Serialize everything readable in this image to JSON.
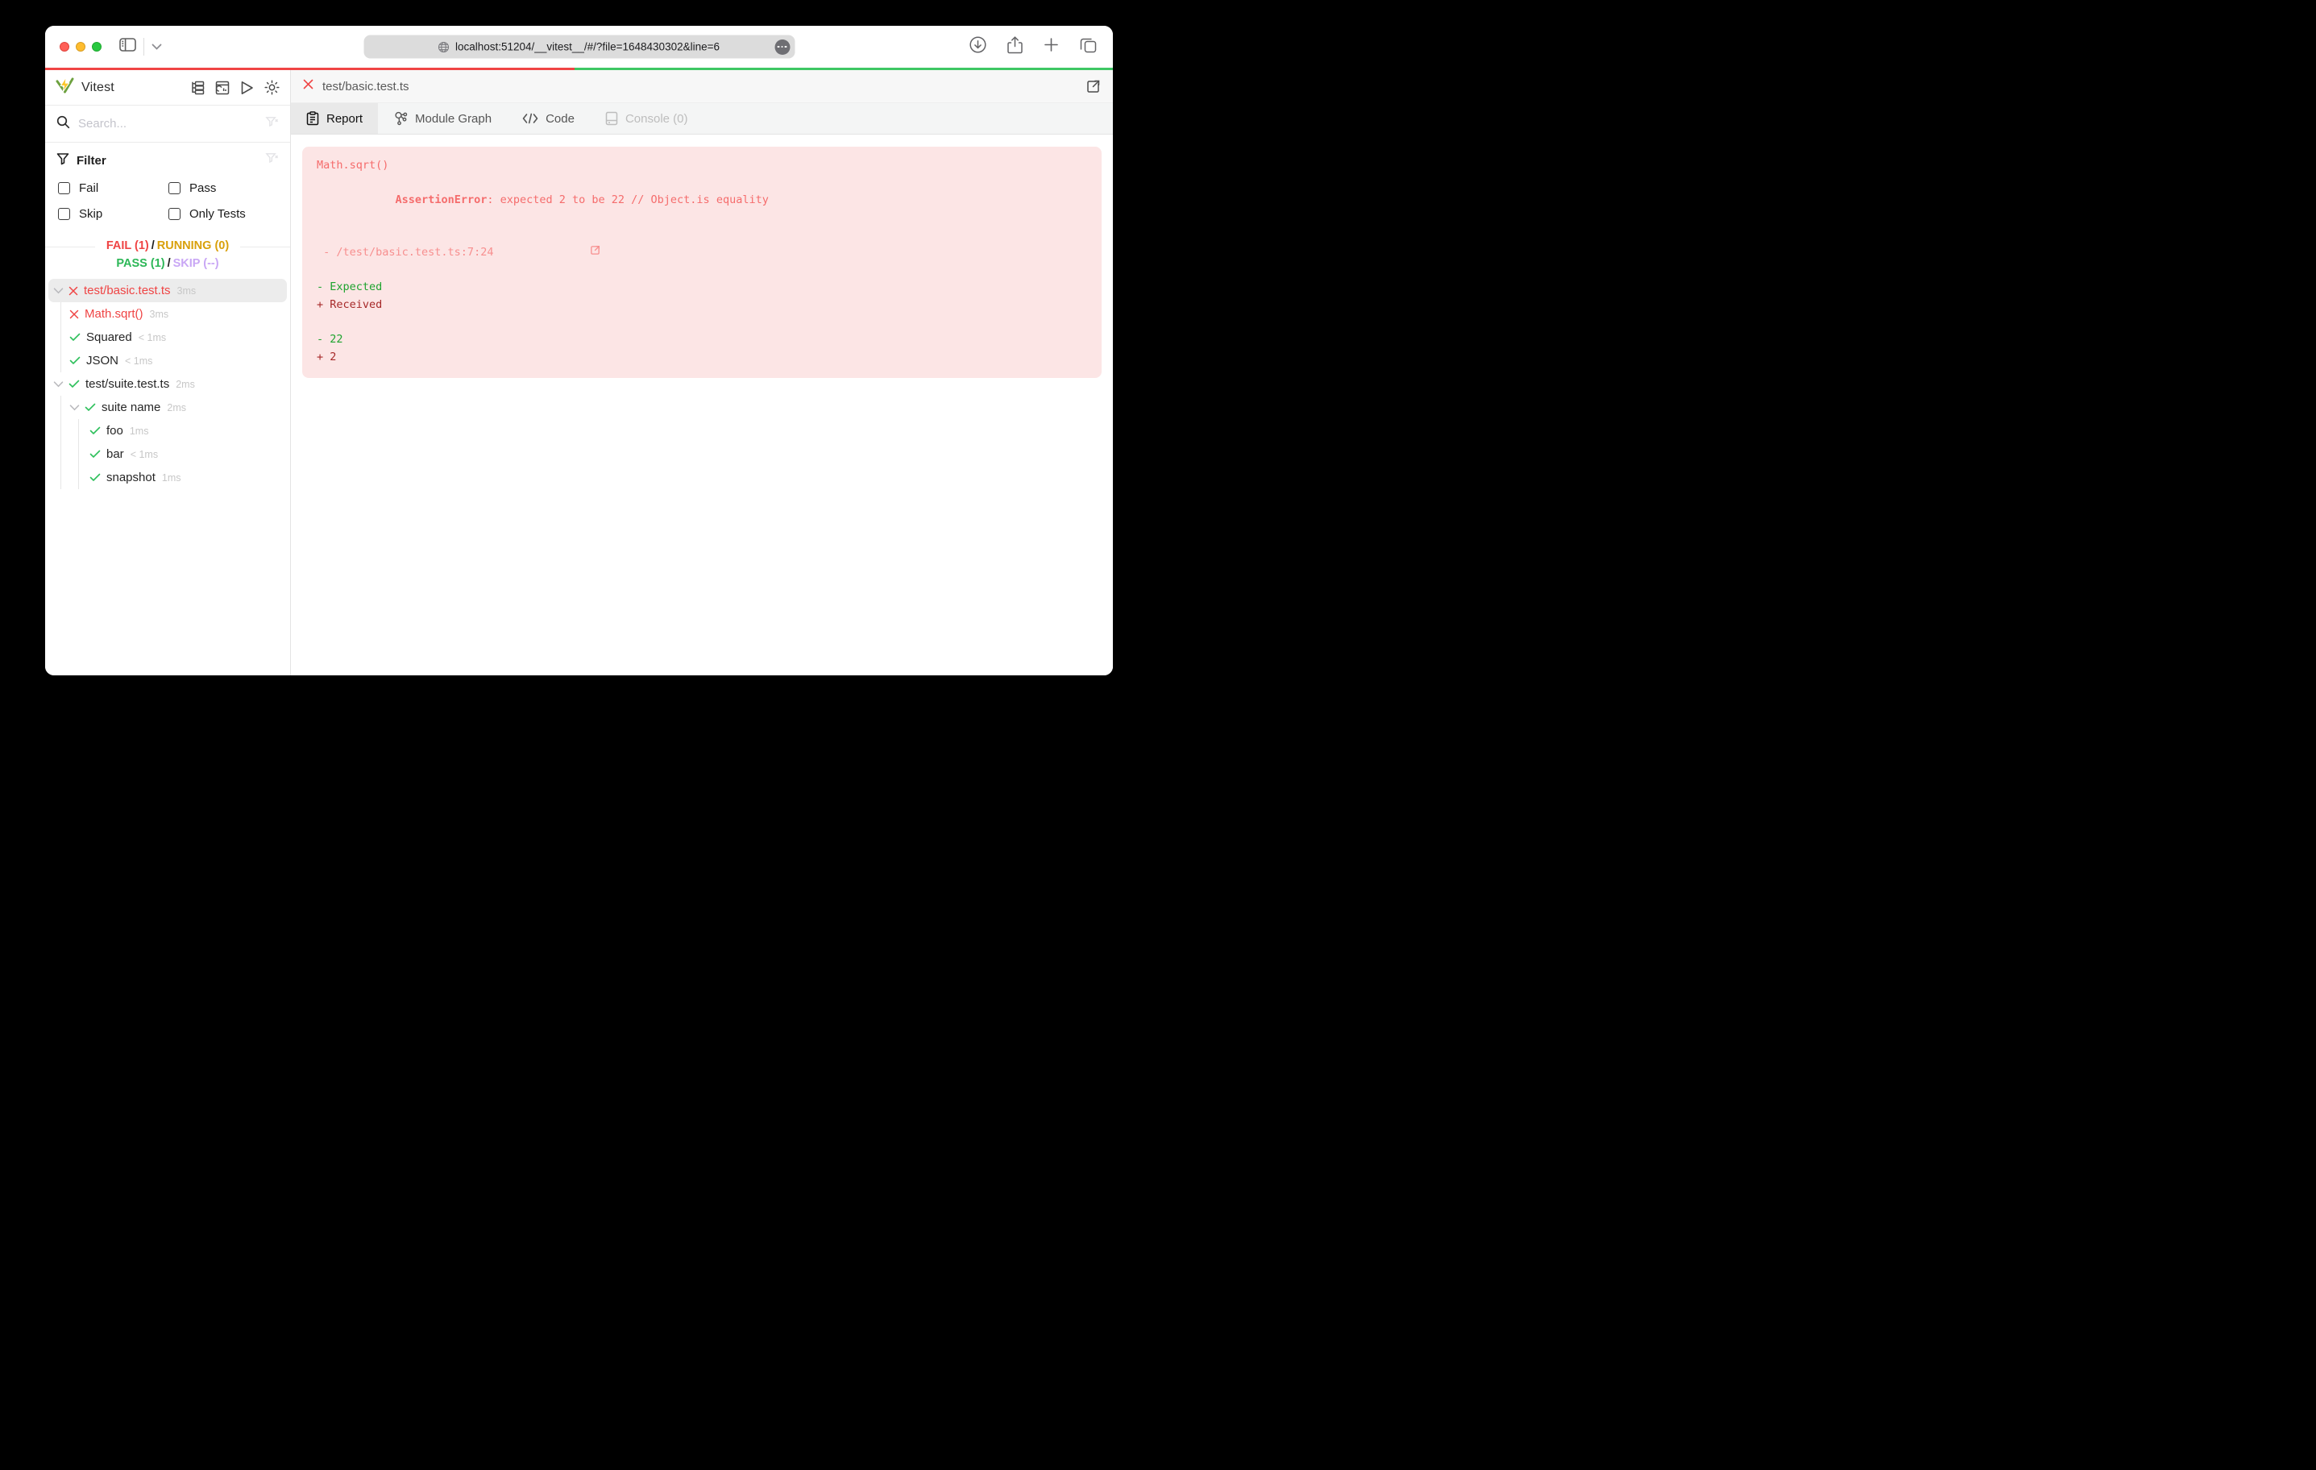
{
  "theme": {
    "accent_fail": "#ef4444",
    "accent_pass": "#2cb757",
    "accent_running": "#d9a00b",
    "accent_skip": "#c9a7f5",
    "check_green": "#2ec05c",
    "error_bg": "#fce5e5",
    "error_text": "#f56c6c",
    "error_location": "#f78f8f",
    "diff_expected": "#1ea32e",
    "diff_received": "#a62828",
    "progress_fail": "#f04545",
    "progress_pass": "#3ec764"
  },
  "browser": {
    "url": "localhost:51204/__vitest__/#/?file=1648430302&line=6",
    "progress_fail_pct": 49.6
  },
  "sidebar": {
    "title": "Vitest",
    "search_placeholder": "Search...",
    "filter": {
      "label": "Filter",
      "options": [
        {
          "label": "Fail"
        },
        {
          "label": "Pass"
        },
        {
          "label": "Skip"
        },
        {
          "label": "Only Tests"
        }
      ]
    },
    "status": {
      "fail": "FAIL (1)",
      "sep1": "/",
      "running": "RUNNING (0)",
      "pass": "PASS (1)",
      "sep2": "/",
      "skip": "SKIP (--)"
    },
    "tree": [
      {
        "name": "test/basic.test.ts",
        "duration": "3ms",
        "state": "fail",
        "expandable": true,
        "selected": true,
        "children": [
          {
            "name": "Math.sqrt()",
            "duration": "3ms",
            "state": "fail"
          },
          {
            "name": "Squared",
            "duration": "< 1ms",
            "state": "pass"
          },
          {
            "name": "JSON",
            "duration": "< 1ms",
            "state": "pass"
          }
        ]
      },
      {
        "name": "test/suite.test.ts",
        "duration": "2ms",
        "state": "pass",
        "expandable": true,
        "children": [
          {
            "name": "suite name",
            "duration": "2ms",
            "state": "pass",
            "expandable": true,
            "children": [
              {
                "name": "foo",
                "duration": "1ms",
                "state": "pass"
              },
              {
                "name": "bar",
                "duration": "< 1ms",
                "state": "pass"
              },
              {
                "name": "snapshot",
                "duration": "1ms",
                "state": "pass"
              }
            ]
          }
        ]
      }
    ]
  },
  "main": {
    "tab_title": "test/basic.test.ts",
    "tabs": [
      {
        "label": "Report",
        "icon": "report-icon",
        "active": true
      },
      {
        "label": "Module Graph",
        "icon": "module-graph-icon"
      },
      {
        "label": "Code",
        "icon": "code-icon"
      },
      {
        "label": "Console (0)",
        "icon": "console-icon",
        "disabled": true
      }
    ],
    "report": {
      "title": "Math.sqrt()",
      "error_name": "AssertionError",
      "error_message": ": expected 2 to be 22 // Object.is equality",
      "location": " - /test/basic.test.ts:7:24",
      "diff_expected_label": "- Expected",
      "diff_received_label": "+ Received",
      "diff_expected_value": "- 22",
      "diff_received_value": "+ 2"
    }
  }
}
